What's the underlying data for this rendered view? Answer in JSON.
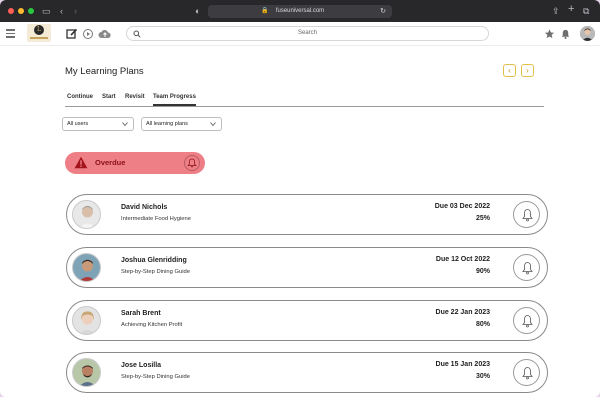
{
  "browser": {
    "url": "fuseuniversal.com",
    "dots": [
      "#ff5f57",
      "#febc2e",
      "#28c840"
    ]
  },
  "appbar": {
    "logo_letter": "L",
    "search_placeholder": "Search"
  },
  "page": {
    "title": "My Learning Plans",
    "prev_label": "‹",
    "next_label": "›"
  },
  "tabs": [
    {
      "label": "Continue",
      "active": false
    },
    {
      "label": "Start",
      "active": false
    },
    {
      "label": "Revisit",
      "active": false
    },
    {
      "label": "Team Progress",
      "active": true
    }
  ],
  "filters": {
    "users": "All users",
    "plans": "All learning plans"
  },
  "overdue": {
    "label": "Overdue",
    "color": "#ef7f86"
  },
  "learners": [
    {
      "name": "David Nichols",
      "course": "Intermediate Food Hygiene",
      "due": "Due 03 Dec 2022",
      "progress": "25%"
    },
    {
      "name": "Joshua Glenridding",
      "course": "Step-by-Step Dining Guide",
      "due": "Due 12 Oct 2022",
      "progress": "90%"
    },
    {
      "name": "Sarah Brent",
      "course": "Achieving Kitchen Profit",
      "due": "Due 22 Jan 2023",
      "progress": "80%"
    },
    {
      "name": "Jose Losilla",
      "course": "Step-by-Step Dining Guide",
      "due": "Due 15 Jan 2023",
      "progress": "30%"
    }
  ]
}
